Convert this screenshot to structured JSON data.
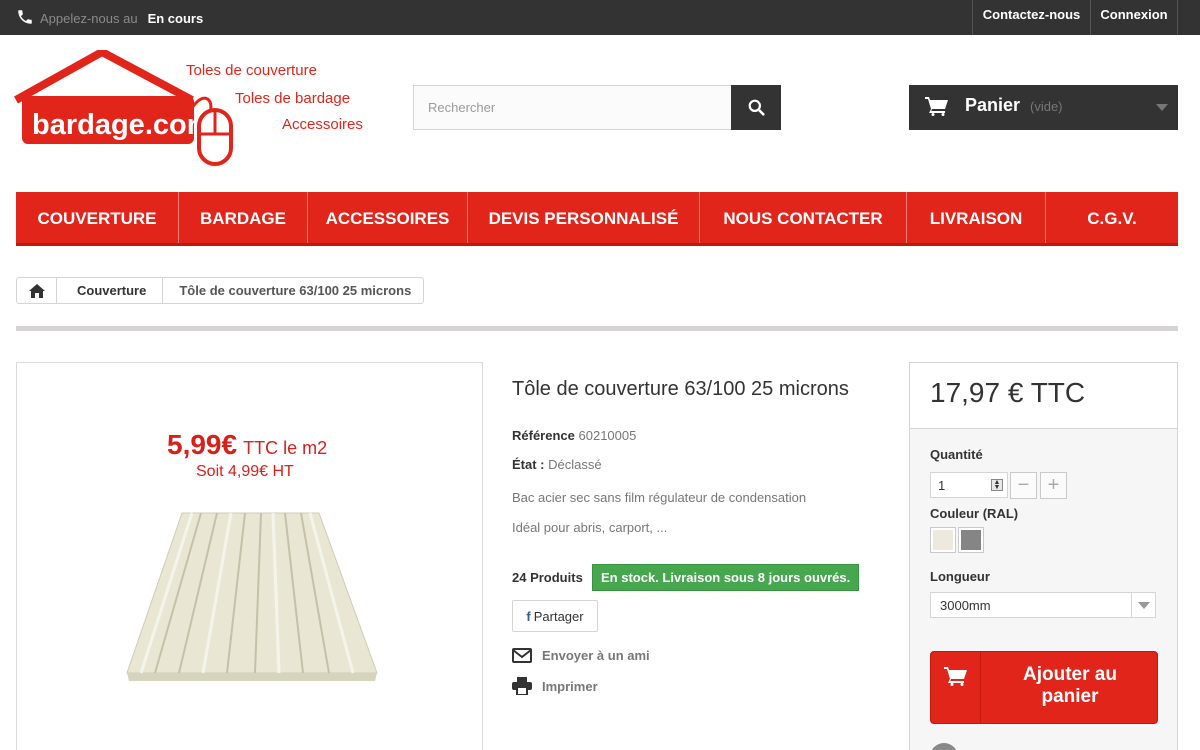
{
  "topbar": {
    "phone_label": "Appelez-nous au",
    "phone_value": "En cours",
    "contact": "Contactez-nous",
    "login": "Connexion"
  },
  "logo": {
    "name": "bardage.com",
    "tag1": "Toles de couverture",
    "tag2": "Toles de bardage",
    "tag3": "Accessoires",
    "color": "#e1251b"
  },
  "search": {
    "placeholder": "Rechercher"
  },
  "cart": {
    "title": "Panier",
    "empty": "(vide)"
  },
  "nav": {
    "items": [
      {
        "label": "COUVERTURE"
      },
      {
        "label": "BARDAGE"
      },
      {
        "label": "ACCESSOIRES"
      },
      {
        "label": "DEVIS PERSONNALISÉ"
      },
      {
        "label": "NOUS CONTACTER"
      },
      {
        "label": "LIVRAISON"
      },
      {
        "label": "C.G.V."
      }
    ]
  },
  "breadcrumb": {
    "category": "Couverture",
    "current": "Tôle de couverture 63/100 25 microns"
  },
  "image": {
    "promo_price": "5,99€",
    "promo_unit": "TTC le m2",
    "promo_ht": "Soit 4,99€ HT"
  },
  "product": {
    "title": "Tôle de couverture 63/100 25 microns",
    "ref_label": "Référence",
    "ref_value": "60210005",
    "state_label": "État :",
    "state_value": "Déclassé",
    "desc1": "Bac acier sec sans film régulateur de condensation",
    "desc2": "Idéal pour abris, carport, ...",
    "qty_count": "24 Produits",
    "stock": "En stock. Livraison sous 8 jours ouvrés.",
    "share": "Partager",
    "send_friend": "Envoyer à un ami",
    "print": "Imprimer"
  },
  "buy": {
    "price": "17,97 € TTC",
    "qty_label": "Quantité",
    "qty_value": "1",
    "color_label": "Couleur (RAL)",
    "swatches": [
      "#ede9de",
      "#858585"
    ],
    "length_label": "Longueur",
    "length_value": "3000mm",
    "add_line1": "Ajouter au",
    "add_line2": "panier"
  },
  "colors": {
    "accent": "#e1251b",
    "dark": "#333333",
    "stock_green": "#46a74e"
  }
}
